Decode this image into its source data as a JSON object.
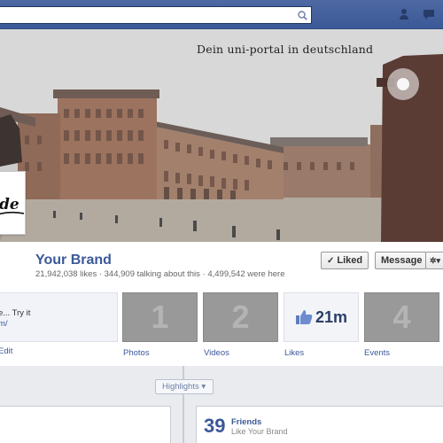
{
  "search": {
    "placeholder": "",
    "value": ""
  },
  "cover": {
    "tagline": "Dein uni-portal in deutschland"
  },
  "profile": {
    "logo_text": "de"
  },
  "page": {
    "name": "Your Brand",
    "stats": "21,942,038 likes · 344,909 talking about this · 4,499,542 were here"
  },
  "actions": {
    "liked_label": "Liked",
    "liked_check": "✓",
    "message_label": "Message",
    "gear_glyph": "✲▾"
  },
  "about": {
    "text": "e... Try it",
    "link": "m/",
    "edit": "Edit"
  },
  "tiles": [
    {
      "display": "1",
      "label": "Photos"
    },
    {
      "display": "2",
      "label": "Videos"
    },
    {
      "display": "21m",
      "label": "Likes"
    },
    {
      "display": "4",
      "label": "Events"
    }
  ],
  "timeline": {
    "highlights_label": "Highlights ▾",
    "friends_count": "39",
    "friends_label": "Friends",
    "friends_sub": "Like Your Brand"
  },
  "colors": {
    "brand_blue": "#3b5998",
    "topbar": "#3b5998"
  }
}
